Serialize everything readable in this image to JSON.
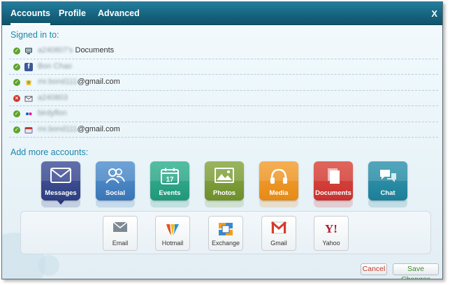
{
  "tabs": [
    {
      "label": "Accounts",
      "active": true
    },
    {
      "label": "Profile",
      "active": false
    },
    {
      "label": "Advanced",
      "active": false
    }
  ],
  "close_label": "X",
  "signed_in_title": "Signed in to:",
  "accounts": [
    {
      "status": "ok",
      "icon": "computer-icon",
      "text_blurred": "a240807's",
      "text_plain": " Documents"
    },
    {
      "status": "ok",
      "icon": "facebook-icon",
      "text_blurred": "Bon Chao",
      "text_plain": ""
    },
    {
      "status": "ok",
      "icon": "gmail-chat-icon",
      "text_blurred": "mr.bond111",
      "text_plain": "@gmail.com"
    },
    {
      "status": "err",
      "icon": "mail-icon",
      "text_blurred": "a240803",
      "text_plain": ""
    },
    {
      "status": "ok",
      "icon": "flickr-icon",
      "text_blurred": "birdyflon",
      "text_plain": ""
    },
    {
      "status": "ok",
      "icon": "envelope-icon",
      "text_blurred": "mr.bond111",
      "text_plain": "@gmail.com"
    }
  ],
  "add_more_title": "Add more accounts:",
  "categories": [
    {
      "label": "Messages",
      "color": "#2d3f80",
      "icon": "envelope-icon",
      "selected": true
    },
    {
      "label": "Social",
      "color": "#3a76b6",
      "icon": "people-icon",
      "selected": false
    },
    {
      "label": "Events",
      "color": "#21977a",
      "icon": "calendar-icon",
      "selected": false
    },
    {
      "label": "Photos",
      "color": "#6f8f2d",
      "icon": "photo-icon",
      "selected": false
    },
    {
      "label": "Media",
      "color": "#e58a17",
      "icon": "headphones-icon",
      "selected": false
    },
    {
      "label": "Documents",
      "color": "#c8312f",
      "icon": "document-icon",
      "selected": false
    },
    {
      "label": "Chat",
      "color": "#1c7f97",
      "icon": "chat-bubble-icon",
      "selected": false
    }
  ],
  "calendar_day": "17",
  "services": [
    {
      "label": "Email",
      "icon": "envelope-icon"
    },
    {
      "label": "Hotmail",
      "icon": "windows-live-icon"
    },
    {
      "label": "Exchange",
      "icon": "exchange-icon"
    },
    {
      "label": "Gmail",
      "icon": "gmail-icon"
    },
    {
      "label": "Yahoo",
      "icon": "yahoo-icon"
    }
  ],
  "yahoo_glyph": "Y!",
  "buttons": {
    "cancel": "Cancel",
    "save": "Save Changes"
  }
}
